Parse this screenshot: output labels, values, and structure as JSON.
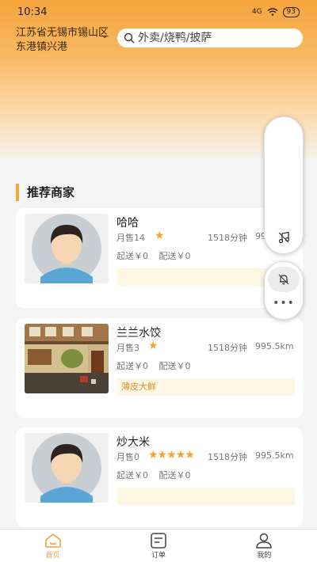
{
  "status": {
    "time": "10:34",
    "signal": "4G",
    "battery": "93"
  },
  "location": "江苏省无锡市锡山区东港镇兴港",
  "search": {
    "placeholder": "外卖/烧鸭/披萨"
  },
  "section_title": "推荐商家",
  "shops": [
    {
      "name": "哈哈",
      "sales": "月售14",
      "stars": 1,
      "time": "1518分钟",
      "distance": "995.5km",
      "start_price": "起送￥0",
      "delivery_fee": "配送￥0",
      "tag": "",
      "image": "avatar-icon"
    },
    {
      "name": "兰兰水饺",
      "sales": "月售3",
      "stars": 1,
      "time": "1518分钟",
      "distance": "995.5km",
      "start_price": "起送￥0",
      "delivery_fee": "配送￥0",
      "tag": "薄皮大鲜",
      "image": "street-photo"
    },
    {
      "name": "炒大米",
      "sales": "月售0",
      "stars": 5,
      "time": "1518分钟",
      "distance": "995.5km",
      "start_price": "起送￥0",
      "delivery_fee": "配送￥0",
      "tag": "",
      "image": "avatar-icon"
    }
  ],
  "tabbar": [
    {
      "label": "首页",
      "icon": "home-icon",
      "active": true
    },
    {
      "label": "订单",
      "icon": "order-icon",
      "active": false
    },
    {
      "label": "我的",
      "icon": "profile-icon",
      "active": false
    }
  ],
  "colors": {
    "accent": "#f4a73a",
    "star": "#f4a42a",
    "tag_bg": "#fdf6e3"
  }
}
